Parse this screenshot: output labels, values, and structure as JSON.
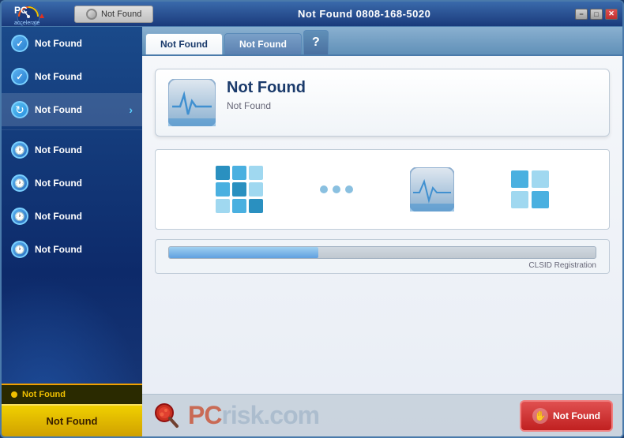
{
  "window": {
    "title": "PC Accelerate",
    "controls": {
      "minimize": "−",
      "maximize": "□",
      "close": "✕"
    }
  },
  "titlebar": {
    "status_btn": "Not Found",
    "main_label": "Not Found  0808-168-5020"
  },
  "tabs": [
    {
      "id": "tab1",
      "label": "Not Found",
      "active": true
    },
    {
      "id": "tab2",
      "label": "Not Found",
      "active": false
    },
    {
      "id": "tab3",
      "label": "?",
      "active": false
    }
  ],
  "sidebar": {
    "items": [
      {
        "id": "item1",
        "label": "Not Found",
        "icon": "check",
        "active": false
      },
      {
        "id": "item2",
        "label": "Not Found",
        "icon": "check",
        "active": false
      },
      {
        "id": "item3",
        "label": "Not Found",
        "icon": "refresh",
        "active": true
      },
      {
        "id": "item4",
        "label": "Not Found",
        "icon": "clock",
        "active": false
      },
      {
        "id": "item5",
        "label": "Not Found",
        "icon": "clock",
        "active": false
      },
      {
        "id": "item6",
        "label": "Not Found",
        "icon": "clock",
        "active": false
      },
      {
        "id": "item7",
        "label": "Not Found",
        "icon": "clock",
        "active": false
      }
    ],
    "warning": {
      "text": "Not Found"
    },
    "cta_button": "Not Found"
  },
  "content": {
    "info_title": "Not Found",
    "info_subtitle": "Not Found",
    "progress_label": "CLSID Registration",
    "progress_value": 35
  },
  "bottom": {
    "stop_button": "Not Found",
    "pcrisk_prefix": "PC",
    "pcrisk_suffix": "risk.com"
  }
}
